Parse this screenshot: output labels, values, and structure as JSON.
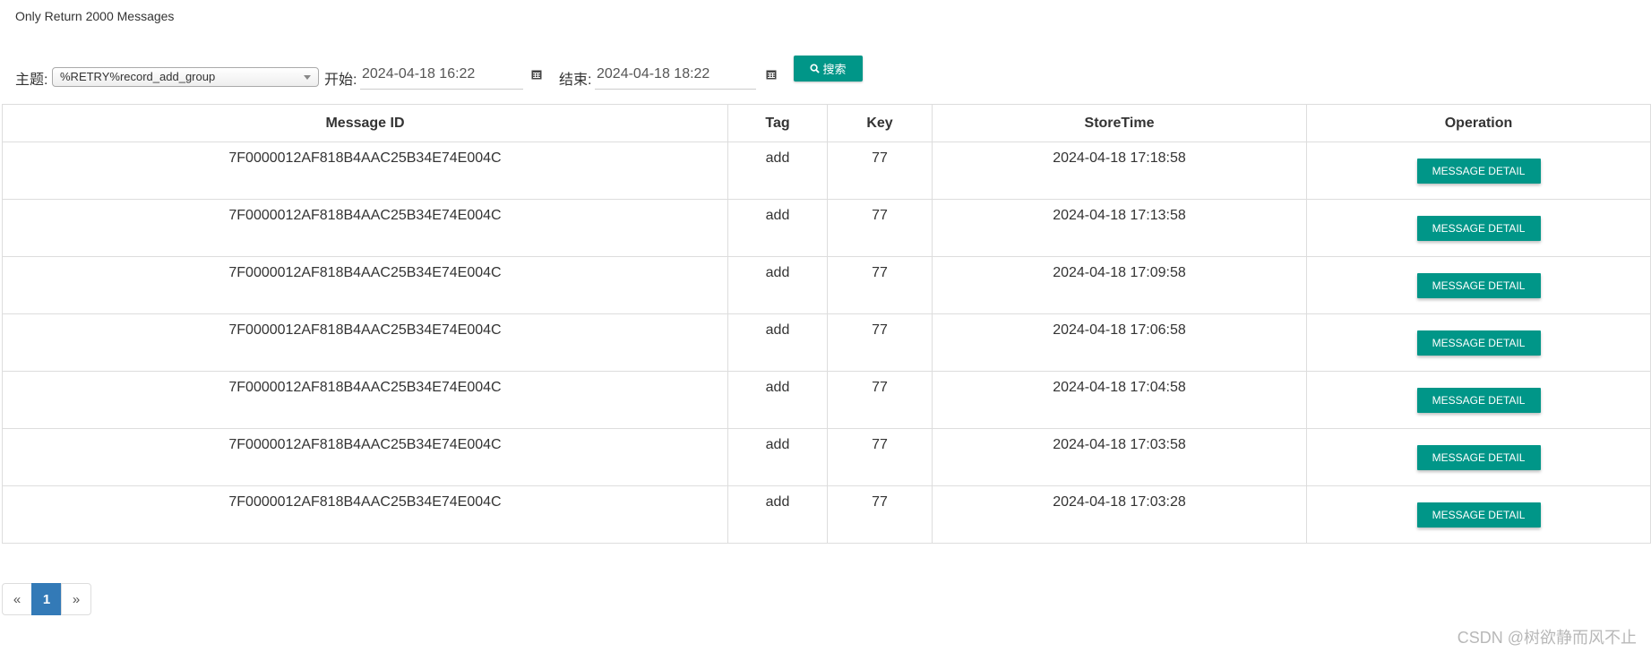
{
  "notice": "Only Return 2000 Messages",
  "filters": {
    "topic_label": "主题:",
    "topic_value": "%RETRY%record_add_group",
    "start_label": "开始:",
    "start_value": "2024-04-18 16:22",
    "end_label": "结束:",
    "end_value": "2024-04-18 18:22",
    "search_label": "搜索"
  },
  "table": {
    "headers": [
      "Message ID",
      "Tag",
      "Key",
      "StoreTime",
      "Operation"
    ],
    "button_label": "MESSAGE DETAIL",
    "rows": [
      {
        "id": "7F0000012AF818B4AAC25B34E74E004C",
        "tag": "add",
        "key": "77",
        "time": "2024-04-18 17:18:58"
      },
      {
        "id": "7F0000012AF818B4AAC25B34E74E004C",
        "tag": "add",
        "key": "77",
        "time": "2024-04-18 17:13:58"
      },
      {
        "id": "7F0000012AF818B4AAC25B34E74E004C",
        "tag": "add",
        "key": "77",
        "time": "2024-04-18 17:09:58"
      },
      {
        "id": "7F0000012AF818B4AAC25B34E74E004C",
        "tag": "add",
        "key": "77",
        "time": "2024-04-18 17:06:58"
      },
      {
        "id": "7F0000012AF818B4AAC25B34E74E004C",
        "tag": "add",
        "key": "77",
        "time": "2024-04-18 17:04:58"
      },
      {
        "id": "7F0000012AF818B4AAC25B34E74E004C",
        "tag": "add",
        "key": "77",
        "time": "2024-04-18 17:03:58"
      },
      {
        "id": "7F0000012AF818B4AAC25B34E74E004C",
        "tag": "add",
        "key": "77",
        "time": "2024-04-18 17:03:28"
      }
    ]
  },
  "pagination": {
    "prev": "«",
    "current": "1",
    "next": "»"
  },
  "watermark": "CSDN @树欲静而风不止",
  "colors": {
    "accent": "#009688",
    "page_active": "#337ab7"
  },
  "icons": {
    "calendar": "calendar-icon",
    "search": "search-icon",
    "dropdown": "chevron-down-icon"
  }
}
